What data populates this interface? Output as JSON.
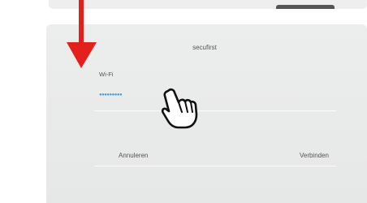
{
  "dialog": {
    "title": "secufirst",
    "wifi_label": "Wi-Fi",
    "password_masked": "●●●●●●●●●",
    "cancel_label": "Annuleren",
    "connect_label": "Verbinden"
  },
  "colors": {
    "arrow": "#e3201b",
    "password_dots": "#4a9bd0",
    "dialog_bg": "#e9eaea",
    "text": "#555555"
  },
  "icons": {
    "pointer": "pointing-hand-cursor-icon",
    "arrow": "down-arrow-icon"
  }
}
